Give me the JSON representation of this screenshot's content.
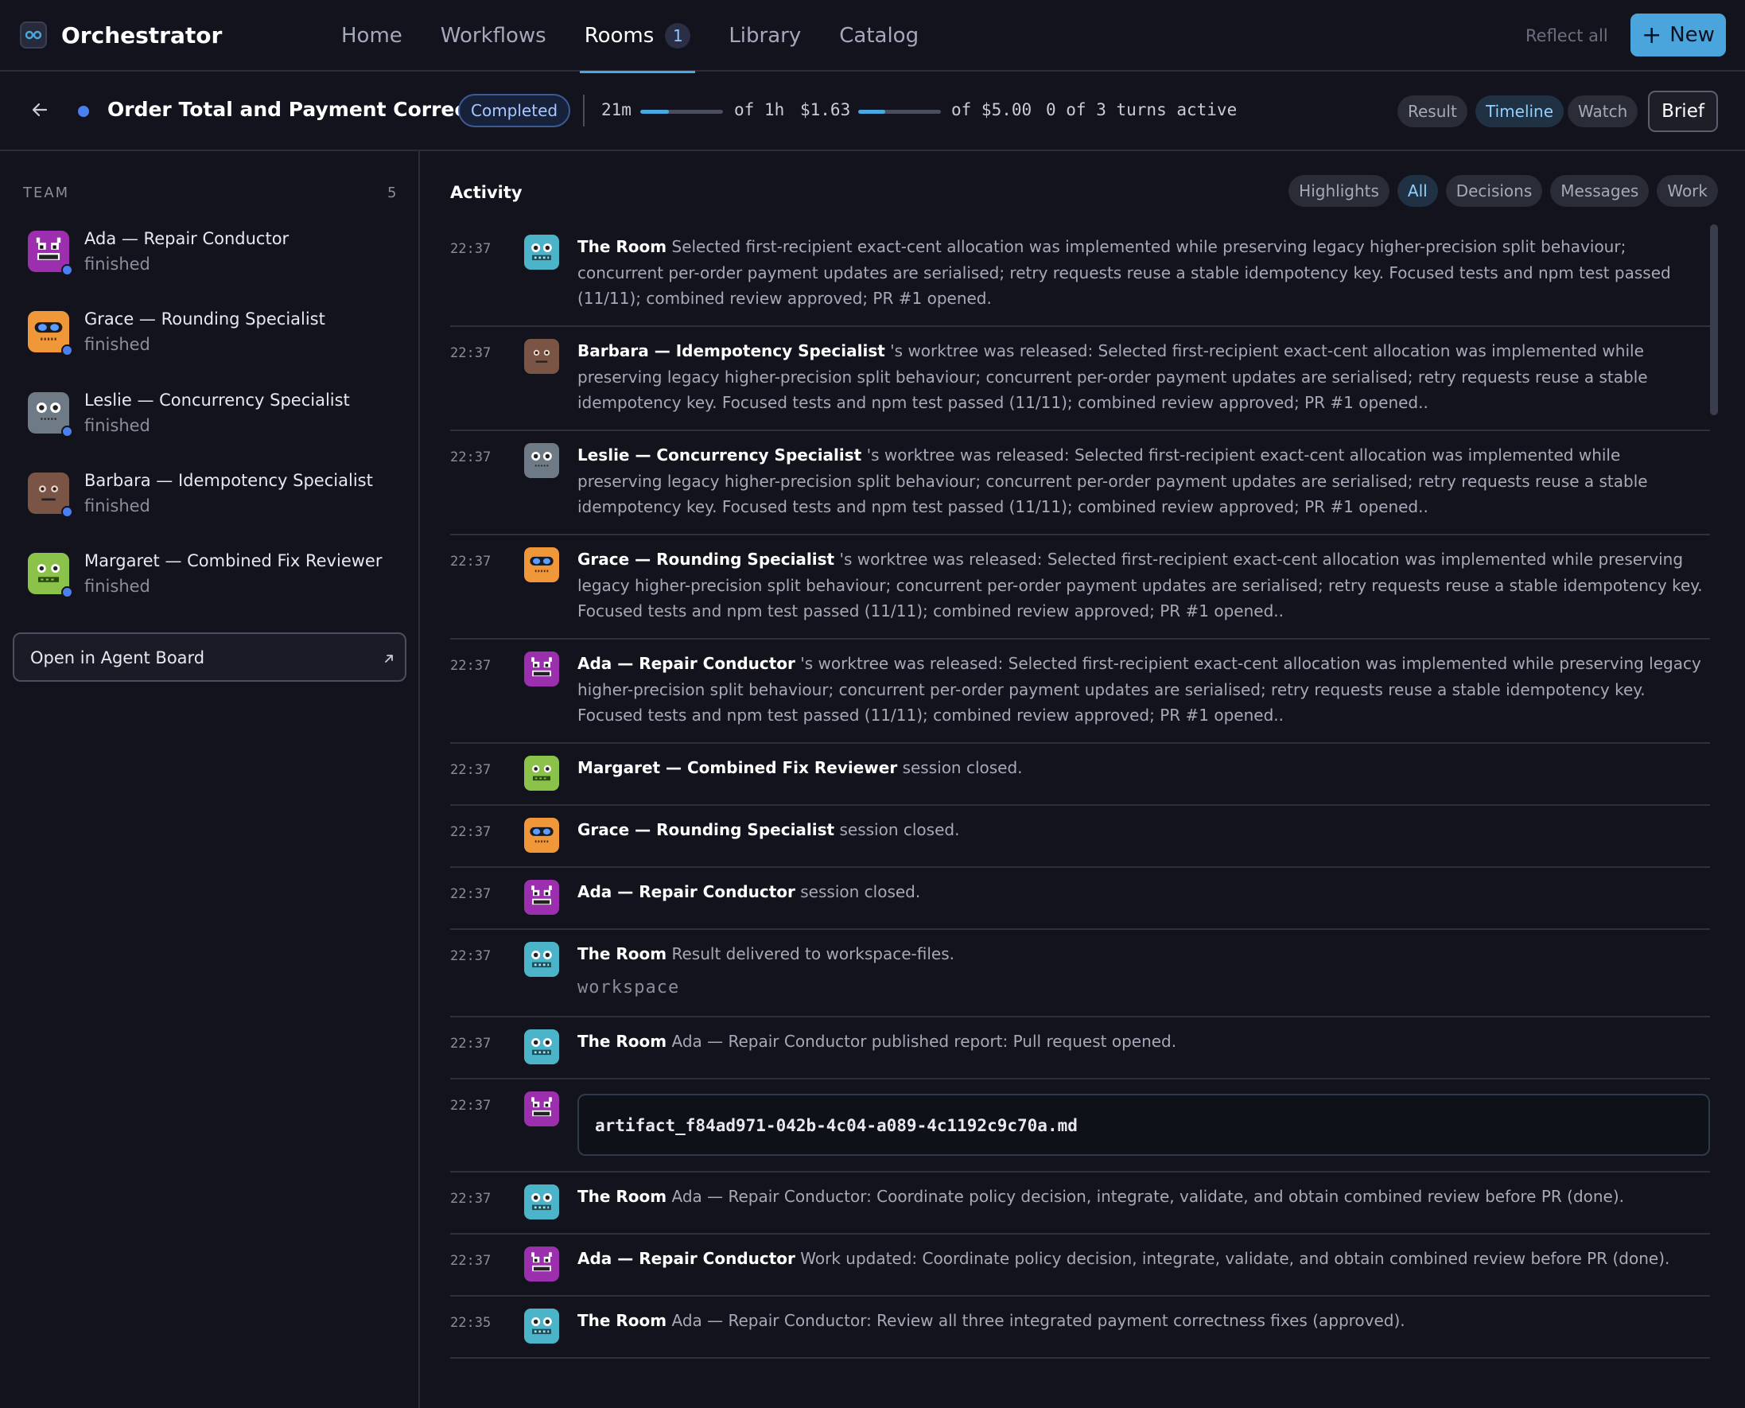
{
  "nav": {
    "brand": "Orchestrator",
    "tabs": [
      {
        "label": "Home"
      },
      {
        "label": "Workflows"
      },
      {
        "label": "Rooms",
        "badge": "1"
      },
      {
        "label": "Library"
      },
      {
        "label": "Catalog"
      }
    ],
    "active_tab": "Rooms",
    "reflect_all": "Reflect all",
    "new_label": "New"
  },
  "room": {
    "title": "Order Total and Payment Correctness",
    "status": "Completed",
    "time_used": "21m",
    "time_total": "of 1h",
    "time_progress": 0.35,
    "cost_used": "$1.63",
    "cost_total": "of $5.00",
    "cost_progress": 0.33,
    "turns": "0 of 3 turns active",
    "view_pills": [
      "Result",
      "Timeline",
      "Watch"
    ],
    "active_view": "Timeline",
    "brief_label": "Brief"
  },
  "team": {
    "label": "TEAM",
    "count": "5",
    "members": [
      {
        "name": "Ada — Repair Conductor",
        "status": "finished",
        "avatar": "purple-robot-icon"
      },
      {
        "name": "Grace — Rounding Specialist",
        "status": "finished",
        "avatar": "orange-robot-icon"
      },
      {
        "name": "Leslie — Concurrency Specialist",
        "status": "finished",
        "avatar": "gray-robot-icon"
      },
      {
        "name": "Barbara — Idempotency Specialist",
        "status": "finished",
        "avatar": "brown-robot-icon"
      },
      {
        "name": "Margaret — Combined Fix Reviewer",
        "status": "finished",
        "avatar": "green-robot-icon"
      }
    ],
    "agent_board_label": "Open in Agent Board"
  },
  "activity": {
    "title": "Activity",
    "filters": [
      "Highlights",
      "All",
      "Decisions",
      "Messages",
      "Work"
    ],
    "active_filter": "All",
    "entries": [
      {
        "time": "22:37",
        "avatar": "teal-robot-icon",
        "actor": "The Room",
        "text": "Selected first-recipient exact-cent allocation was implemented while preserving legacy higher-precision split behaviour; concurrent per-order payment updates are serialised; retry requests reuse a stable idempotency key. Focused tests and npm test passed (11/11); combined review approved; PR #1 opened."
      },
      {
        "time": "22:37",
        "avatar": "brown-robot-icon",
        "actor": "Barbara — Idempotency Specialist",
        "text": "'s worktree was released: Selected first-recipient exact-cent allocation was implemented while preserving legacy higher-precision split behaviour; concurrent per-order payment updates are serialised; retry requests reuse a stable idempotency key. Focused tests and npm test passed (11/11); combined review approved; PR #1 opened.."
      },
      {
        "time": "22:37",
        "avatar": "gray-robot-icon",
        "actor": "Leslie — Concurrency Specialist",
        "text": "'s worktree was released: Selected first-recipient exact-cent allocation was implemented while preserving legacy higher-precision split behaviour; concurrent per-order payment updates are serialised; retry requests reuse a stable idempotency key. Focused tests and npm test passed (11/11); combined review approved; PR #1 opened.."
      },
      {
        "time": "22:37",
        "avatar": "orange-robot-icon",
        "actor": "Grace — Rounding Specialist",
        "text": "'s worktree was released: Selected first-recipient exact-cent allocation was implemented while preserving legacy higher-precision split behaviour; concurrent per-order payment updates are serialised; retry requests reuse a stable idempotency key. Focused tests and npm test passed (11/11); combined review approved; PR #1 opened.."
      },
      {
        "time": "22:37",
        "avatar": "purple-robot-icon",
        "actor": "Ada — Repair Conductor",
        "text": "'s worktree was released: Selected first-recipient exact-cent allocation was implemented while preserving legacy higher-precision split behaviour; concurrent per-order payment updates are serialised; retry requests reuse a stable idempotency key. Focused tests and npm test passed (11/11); combined review approved; PR #1 opened.."
      },
      {
        "time": "22:37",
        "avatar": "green-robot-icon",
        "actor": "Margaret — Combined Fix Reviewer",
        "text": "session closed."
      },
      {
        "time": "22:37",
        "avatar": "orange-robot-icon",
        "actor": "Grace — Rounding Specialist",
        "text": "session closed."
      },
      {
        "time": "22:37",
        "avatar": "purple-robot-icon",
        "actor": "Ada — Repair Conductor",
        "text": "session closed."
      },
      {
        "time": "22:37",
        "avatar": "teal-robot-icon",
        "actor": "The Room",
        "text": "Result delivered to workspace-files.",
        "extra": "workspace"
      },
      {
        "time": "22:37",
        "avatar": "teal-robot-icon",
        "actor": "The Room",
        "text": "Ada — Repair Conductor published report: Pull request opened."
      },
      {
        "time": "22:37",
        "avatar": "purple-robot-icon",
        "actor": "",
        "text": "",
        "artifact": "artifact_f84ad971-042b-4c04-a089-4c1192c9c70a.md"
      },
      {
        "time": "22:37",
        "avatar": "teal-robot-icon",
        "actor": "The Room",
        "text": "Ada — Repair Conductor: Coordinate policy decision, integrate, validate, and obtain combined review before PR (done)."
      },
      {
        "time": "22:37",
        "avatar": "purple-robot-icon",
        "actor": "Ada — Repair Conductor",
        "text": "Work updated: Coordinate policy decision, integrate, validate, and obtain combined review before PR (done)."
      },
      {
        "time": "22:35",
        "avatar": "teal-robot-icon",
        "actor": "The Room",
        "text": "Ada — Repair Conductor: Review all three integrated payment correctness fixes (approved)."
      }
    ]
  },
  "colors": {
    "accent": "#4ba5dd",
    "status_dot": "#4a7ff0",
    "avatar_purple": "#9b2fae",
    "avatar_orange": "#f0973a",
    "avatar_gray": "#6e7a86",
    "avatar_brown": "#7a5444",
    "avatar_green": "#8bc34a",
    "avatar_teal": "#4bb4c8"
  }
}
